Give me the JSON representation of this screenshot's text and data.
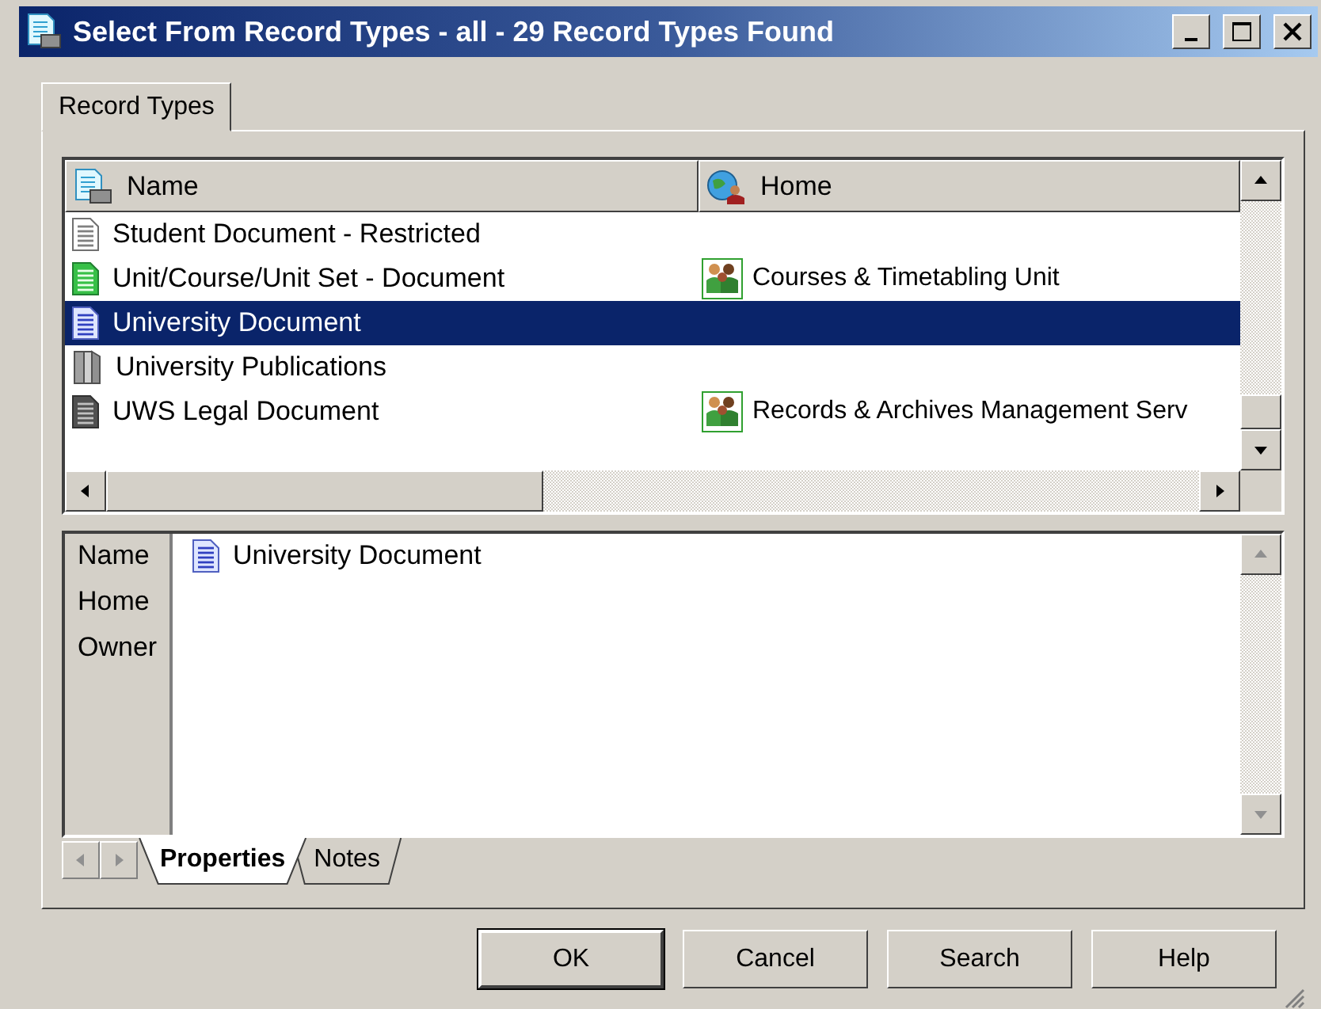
{
  "window": {
    "title": "Select From Record Types - all - 29 Record Types Found"
  },
  "tabs": [
    {
      "label": "Record Types",
      "selected": true
    }
  ],
  "table": {
    "columns": [
      "Name",
      "Home"
    ],
    "rows": [
      {
        "kind": "plain",
        "name": "Student Document - Restricted",
        "selected": false
      },
      {
        "kind": "green",
        "name": "Unit/Course/Unit Set - Document",
        "home": "Courses & Timetabling Unit",
        "selected": false
      },
      {
        "kind": "blue",
        "name": "University Document",
        "selected": true
      },
      {
        "kind": "book",
        "name": "University Publications",
        "selected": false
      },
      {
        "kind": "dark",
        "name": "UWS Legal Document",
        "home": "Records & Archives Management Serv",
        "selected": false
      }
    ]
  },
  "properties": {
    "fields": [
      {
        "label": "Name",
        "value": "University Document",
        "kind": "blue"
      },
      {
        "label": "Home"
      },
      {
        "label": "Owner"
      }
    ]
  },
  "bottom_tabs": [
    {
      "label": "Properties",
      "selected": true
    },
    {
      "label": "Notes",
      "selected": false
    }
  ],
  "buttons": [
    {
      "label": "OK",
      "default": true
    },
    {
      "label": "Cancel",
      "default": false
    },
    {
      "label": "Search",
      "default": false
    },
    {
      "label": "Help",
      "default": false
    }
  ]
}
